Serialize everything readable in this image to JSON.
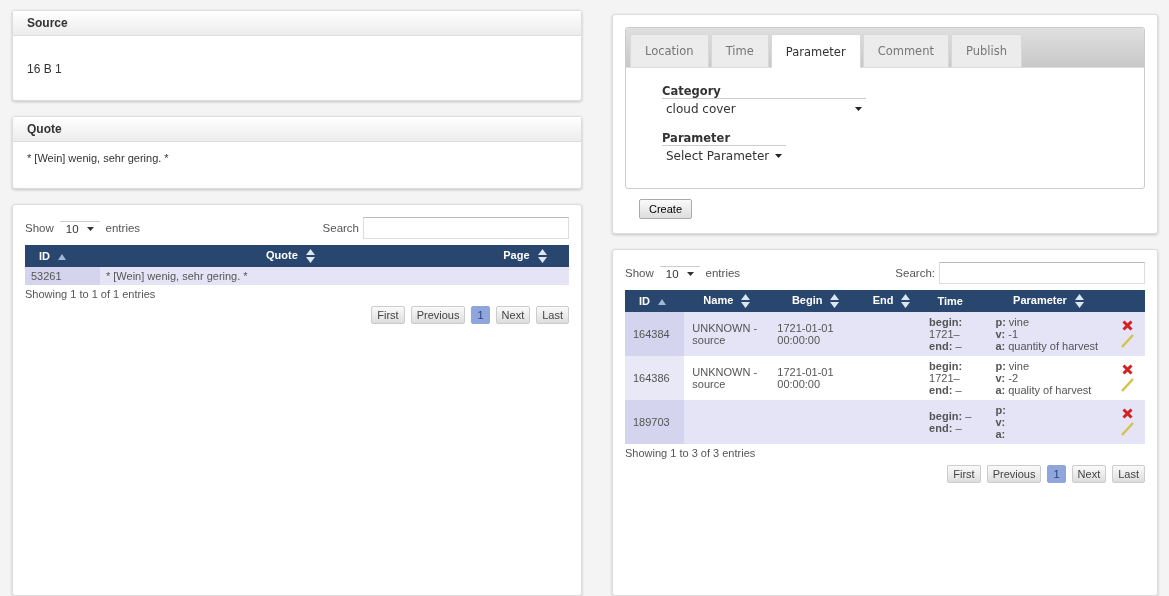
{
  "source": {
    "title": "Source",
    "value": "16 B 1"
  },
  "quote": {
    "title": "Quote",
    "value": "* [Wein] wenig, sehr gering. *"
  },
  "quotes_table": {
    "length": {
      "label_before": "Show",
      "value": "10",
      "label_after": "entries"
    },
    "search": {
      "label": "Search"
    },
    "columns": [
      {
        "label": "ID",
        "sortable": true,
        "sorted_ascending": true
      },
      {
        "label": "Quote",
        "sortable": true,
        "sorted_ascending": false
      },
      {
        "label": "Page",
        "sortable": true,
        "sorted_ascending": false
      }
    ],
    "rows": [
      {
        "cells": [
          "53261",
          "* [Wein] wenig, sehr gering. *",
          ""
        ]
      }
    ],
    "info": "Showing 1 to 1 of 1 entries",
    "pagination": [
      {
        "label": "First",
        "selected": false
      },
      {
        "label": "Previous",
        "selected": false
      },
      {
        "label": "1",
        "selected": true
      },
      {
        "label": "Next",
        "selected": false
      },
      {
        "label": "Last",
        "selected": false
      }
    ]
  },
  "editor": {
    "tabs": [
      {
        "label": "Location",
        "selected": false
      },
      {
        "label": "Time",
        "selected": false
      },
      {
        "label": "Parameter",
        "selected": true
      },
      {
        "label": "Comment",
        "selected": false
      },
      {
        "label": "Publish",
        "selected": false
      }
    ],
    "fields": [
      {
        "label": "Category",
        "value": "cloud cover"
      },
      {
        "label": "Parameter",
        "value": "Select Parameter"
      }
    ],
    "button": "Create"
  },
  "events_table": {
    "length": {
      "label_before": "Show",
      "value": "10",
      "label_after": "entries"
    },
    "search": {
      "label": "Search:"
    },
    "columns": [
      {
        "label": "ID",
        "sortable": true,
        "sorted_ascending": true
      },
      {
        "label": "Name",
        "sortable": true,
        "sorted_ascending": false
      },
      {
        "label": "Begin",
        "sortable": true,
        "sorted_ascending": false
      },
      {
        "label": "End",
        "sortable": true,
        "sorted_ascending": false
      },
      {
        "label": "Time",
        "sortable": false
      },
      {
        "label": "Parameter",
        "sortable": true,
        "sorted_ascending": false
      }
    ],
    "rows": [
      {
        "id": "164384",
        "name": "UNKNOWN - source",
        "begin": "1721-01-01 00:00:00",
        "end": "",
        "time": "**begin:** 1721– **end:** –",
        "parameter": [
          "**p:** vine",
          "**v:** -1",
          "**a:** quantity of harvest"
        ]
      },
      {
        "id": "164386",
        "name": "UNKNOWN - source",
        "begin": "1721-01-01 00:00:00",
        "end": "",
        "time": "**begin:** 1721– **end:** –",
        "parameter": [
          "**p:** vine",
          "**v:** -2",
          "**a:** quality of harvest"
        ]
      },
      {
        "id": "189703",
        "name": "",
        "begin": "",
        "end": "",
        "time": "**begin:** – **end:** –",
        "parameter": [
          "**p:**",
          "**v:**",
          "**a:**"
        ]
      }
    ],
    "info": "Showing 1 to 3 of 3 entries",
    "pagination": [
      {
        "label": "First",
        "selected": false
      },
      {
        "label": "Previous",
        "selected": false
      },
      {
        "label": "1",
        "selected": true
      },
      {
        "label": "Next",
        "selected": false
      },
      {
        "label": "Last",
        "selected": false
      }
    ]
  }
}
